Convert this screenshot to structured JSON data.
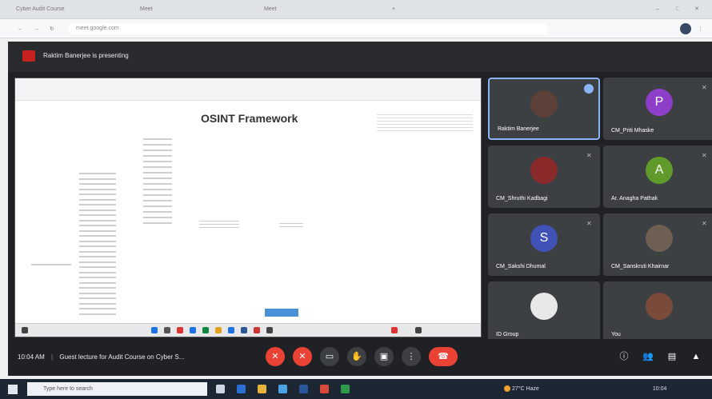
{
  "browser": {
    "tabs": [
      {
        "label": "Cyber Audit Course"
      },
      {
        "label": "Meet"
      },
      {
        "label": "Meet"
      }
    ],
    "url": "meet.google.com"
  },
  "meeting": {
    "presenting_text": "Raktim Banerjee is presenting",
    "shared_screen_title": "OSINT Framework",
    "time_label": "10:04 AM",
    "meeting_name": "Guest lecture for Audit Course on Cyber S...",
    "participants": [
      {
        "name": "Raktim Banerjee",
        "type": "photo",
        "color": "#5d4037",
        "initial": "",
        "active": true
      },
      {
        "name": "CM_Priti Mhaske",
        "type": "letter",
        "color": "#8e3fc9",
        "initial": "P",
        "active": false
      },
      {
        "name": "CM_Shruthi Kadbagi",
        "type": "photo",
        "color": "#8b2a2a",
        "initial": "",
        "active": false
      },
      {
        "name": "Ar. Anagha Pathak",
        "type": "letter",
        "color": "#5f9a2a",
        "initial": "A",
        "active": false
      },
      {
        "name": "CM_Sakshi Dhumal",
        "type": "letter",
        "color": "#4052b5",
        "initial": "S",
        "active": false
      },
      {
        "name": "CM_Sanskruti Khairnar",
        "type": "photo",
        "color": "#6d5f52",
        "initial": "",
        "active": false
      },
      {
        "name": "ID Group",
        "type": "photo",
        "color": "#e8e8e8",
        "initial": "",
        "active": false
      },
      {
        "name": "You",
        "type": "photo",
        "color": "#7a4b3b",
        "initial": "",
        "active": false
      }
    ]
  },
  "windows": {
    "search_placeholder": "Type here to search",
    "tray_text": "27°C Haze",
    "tray_time": "10:04"
  }
}
